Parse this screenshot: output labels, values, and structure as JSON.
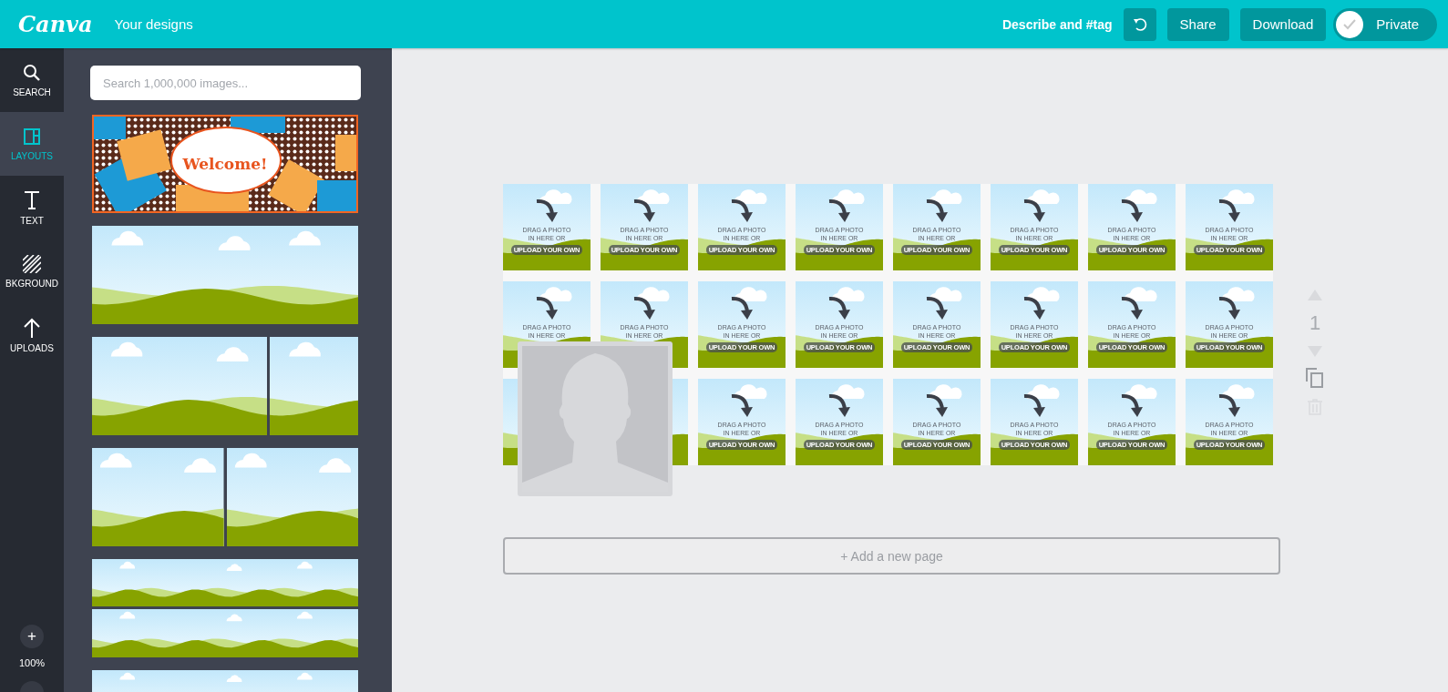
{
  "topbar": {
    "logo": "Canva",
    "nav_link": "Your designs",
    "describe": "Describe and #tag",
    "buttons": [
      "Share",
      "Download"
    ],
    "privacy_toggle": {
      "label": "Private",
      "on": true
    }
  },
  "rail": {
    "items": [
      {
        "label": "SEARCH",
        "kind": "search",
        "selected": false
      },
      {
        "label": "LAYOUTS",
        "kind": "layouts",
        "selected": true
      },
      {
        "label": "TEXT",
        "kind": "text",
        "selected": false
      },
      {
        "label": "BKGROUND",
        "kind": "background",
        "selected": false
      },
      {
        "label": "UPLOADS",
        "kind": "uploads",
        "selected": false
      }
    ],
    "zoom_in": "+",
    "zoom_level": "100%"
  },
  "panel": {
    "search": {
      "placeholder": "Search 1,000,000 images..."
    },
    "layouts": [
      {
        "kind": "welcome",
        "text": "Welcome!",
        "selected": true
      },
      {
        "kind": "single",
        "selected": false
      },
      {
        "kind": "wide-narrow",
        "selected": false
      },
      {
        "kind": "halves",
        "selected": false
      },
      {
        "kind": "two-strips",
        "selected": false
      },
      {
        "kind": "many-strips",
        "selected": false
      }
    ]
  },
  "canvas": {
    "rows": [
      {
        "cells": [
          {
            "lines": [
              "DRAG A PHOTO",
              "IN HERE OR"
            ],
            "button": "UPLOAD YOUR OWN"
          },
          {
            "lines": [
              "DRAG A PHOTO",
              "IN HERE OR"
            ],
            "button": "UPLOAD YOUR OWN"
          },
          {
            "lines": [
              "DRAG A PHOTO",
              "IN HERE OR"
            ],
            "button": "UPLOAD YOUR OWN"
          },
          {
            "lines": [
              "DRAG A PHOTO",
              "IN HERE OR"
            ],
            "button": "UPLOAD YOUR OWN"
          },
          {
            "lines": [
              "DRAG A PHOTO",
              "IN HERE OR"
            ],
            "button": "UPLOAD YOUR OWN"
          },
          {
            "lines": [
              "DRAG A PHOTO",
              "IN HERE OR"
            ],
            "button": "UPLOAD YOUR OWN"
          },
          {
            "lines": [
              "DRAG A PHOTO",
              "IN HERE OR"
            ],
            "button": "UPLOAD YOUR OWN"
          },
          {
            "lines": [
              "DRAG A PHOTO",
              "IN HERE OR"
            ],
            "button": "UPLOAD YOUR OWN"
          }
        ]
      },
      {
        "cells": [
          {
            "lines": [
              "DRAG A PHOTO",
              "IN HERE OR"
            ]
          },
          {
            "lines": [
              "DRAG A PHOTO",
              "IN HERE OR"
            ]
          },
          {
            "lines": [
              "DRAG A PHOTO",
              "IN HERE OR"
            ],
            "button": "UPLOAD YOUR OWN"
          },
          {
            "lines": [
              "DRAG A PHOTO",
              "IN HERE OR"
            ],
            "button": "UPLOAD YOUR OWN"
          },
          {
            "lines": [
              "DRAG A PHOTO",
              "IN HERE OR"
            ],
            "button": "UPLOAD YOUR OWN"
          },
          {
            "lines": [
              "DRAG A PHOTO",
              "IN HERE OR"
            ],
            "button": "UPLOAD YOUR OWN"
          },
          {
            "lines": [
              "DRAG A PHOTO",
              "IN HERE OR"
            ],
            "button": "UPLOAD YOUR OWN"
          },
          {
            "lines": [
              "DRAG A PHOTO",
              "IN HERE OR"
            ],
            "button": "UPLOAD YOUR OWN"
          }
        ]
      },
      {
        "cells": [
          {},
          {},
          {
            "lines": [
              "DRAG A PHOTO",
              "IN HERE OR"
            ],
            "button": "UPLOAD YOUR OWN"
          },
          {
            "lines": [
              "DRAG A PHOTO",
              "IN HERE OR"
            ],
            "button": "UPLOAD YOUR OWN"
          },
          {
            "lines": [
              "DRAG A PHOTO",
              "IN HERE OR"
            ],
            "button": "UPLOAD YOUR OWN"
          },
          {
            "lines": [
              "DRAG A PHOTO",
              "IN HERE OR"
            ],
            "button": "UPLOAD YOUR OWN"
          },
          {
            "lines": [
              "DRAG A PHOTO",
              "IN HERE OR"
            ],
            "button": "UPLOAD YOUR OWN"
          },
          {
            "lines": [
              "DRAG A PHOTO",
              "IN HERE OR"
            ],
            "button": "UPLOAD YOUR OWN"
          }
        ]
      }
    ],
    "page_controls": {
      "page_number": "1",
      "move_up_disabled": true,
      "move_down_disabled": true,
      "delete_disabled": true
    },
    "add_page": "+ Add a new page"
  }
}
